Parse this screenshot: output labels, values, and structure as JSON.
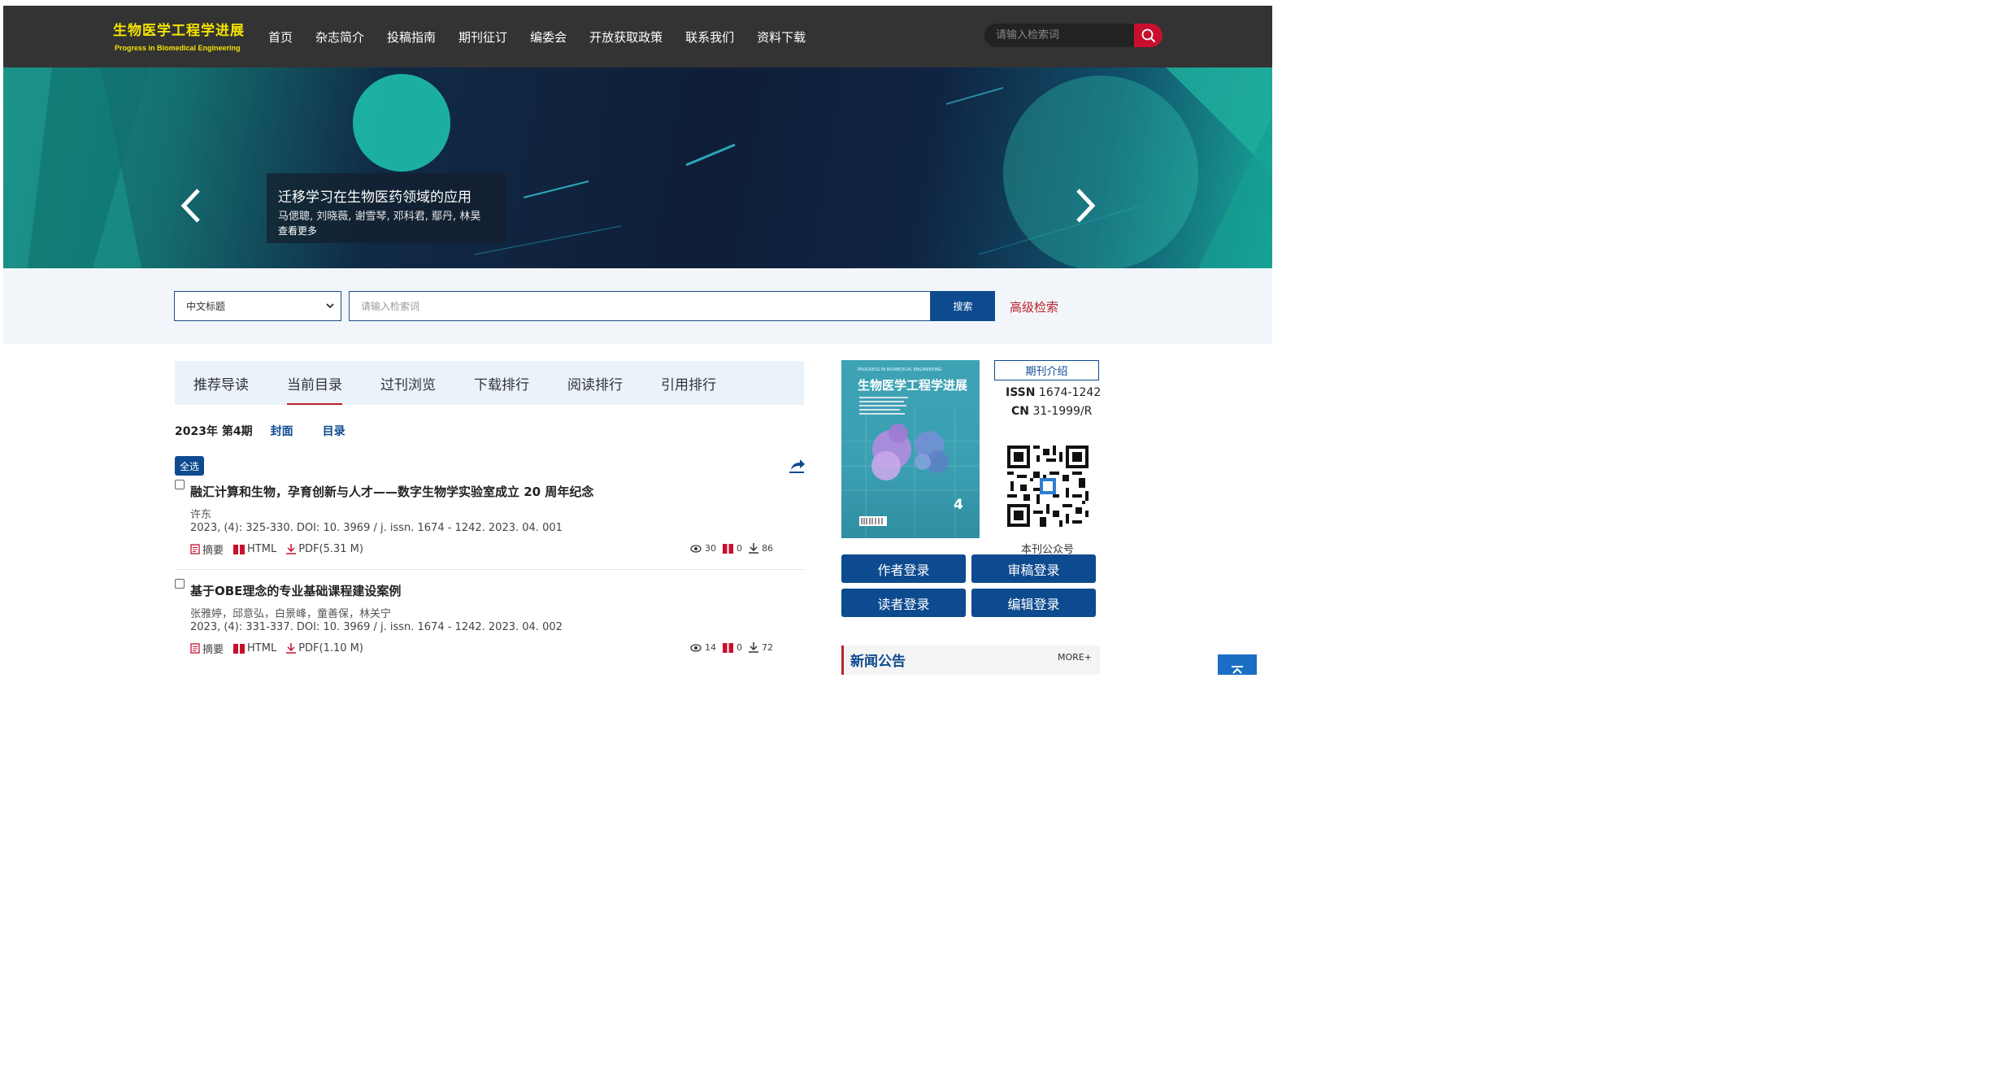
{
  "header": {
    "logo_cn": "生物医学工程学进展",
    "logo_en": "Progress in Biomedical Engineering",
    "nav": [
      "首页",
      "杂志简介",
      "投稿指南",
      "期刊征订",
      "编委会",
      "开放获取政策",
      "联系我们",
      "资料下载"
    ],
    "search_placeholder": "请输入检索词",
    "search_icon": "search-icon"
  },
  "banner": {
    "title": "迁移学习在生物医药领域的应用",
    "authors": "马偲聰, 刘晓薇, 谢雪琴, 邓科君, 鄢丹, 林昊",
    "more": "查看更多"
  },
  "search": {
    "field_selected": "中文标题",
    "placeholder": "请输入检索词",
    "button": "搜索",
    "advanced": "高级检索"
  },
  "tabs": [
    "推荐导读",
    "当前目录",
    "过刊浏览",
    "下载排行",
    "阅读排行",
    "引用排行"
  ],
  "active_tab": "当前目录",
  "issue": {
    "label": "2023年 第4期",
    "cover_link": "封面",
    "toc_link": "目录"
  },
  "select_all": "全选",
  "articles": [
    {
      "title": "融汇计算和生物，孕育创新与人才——数字生物学实验室成立 20 周年纪念",
      "authors": "许东",
      "citation": "2023, (4): 325-330. DOI: 10. 3969 / j. issn. 1674 - 1242. 2023. 04. 001",
      "abstract": "摘要",
      "html": "HTML",
      "pdf": "PDF(5.31 M)",
      "views": "30",
      "cites": "0",
      "downloads": "86"
    },
    {
      "title": "基于OBE理念的专业基础课程建设案例",
      "authors": "张雅婷，邱意弘，白景峰，童善保，林关宁",
      "citation": "2023, (4): 331-337. DOI: 10. 3969 / j. issn. 1674 - 1242. 2023. 04. 002",
      "abstract": "摘要",
      "html": "HTML",
      "pdf": "PDF(1.10 M)",
      "views": "14",
      "cites": "0",
      "downloads": "72"
    }
  ],
  "sidebar": {
    "cover_en": "PROGRESS IN BIOMEDICAL ENGINEERING",
    "cover_cn": "生物医学工程学进展",
    "cover_issue": "4",
    "intro_button": "期刊介绍",
    "issn_label": "ISSN",
    "issn_value": "1674-1242",
    "cn_label": "CN",
    "cn_value": "31-1999/R",
    "qr_label": "本刊公众号",
    "login_buttons": [
      "作者登录",
      "审稿登录",
      "读者登录",
      "编辑登录"
    ],
    "news_title": "新闻公告",
    "news_more": "MORE+"
  },
  "colors": {
    "nav_bg": "#333333",
    "logo": "#f5e400",
    "primary": "#0d4a8f",
    "accent_red": "#b8222b",
    "search_red": "#c8102e"
  }
}
